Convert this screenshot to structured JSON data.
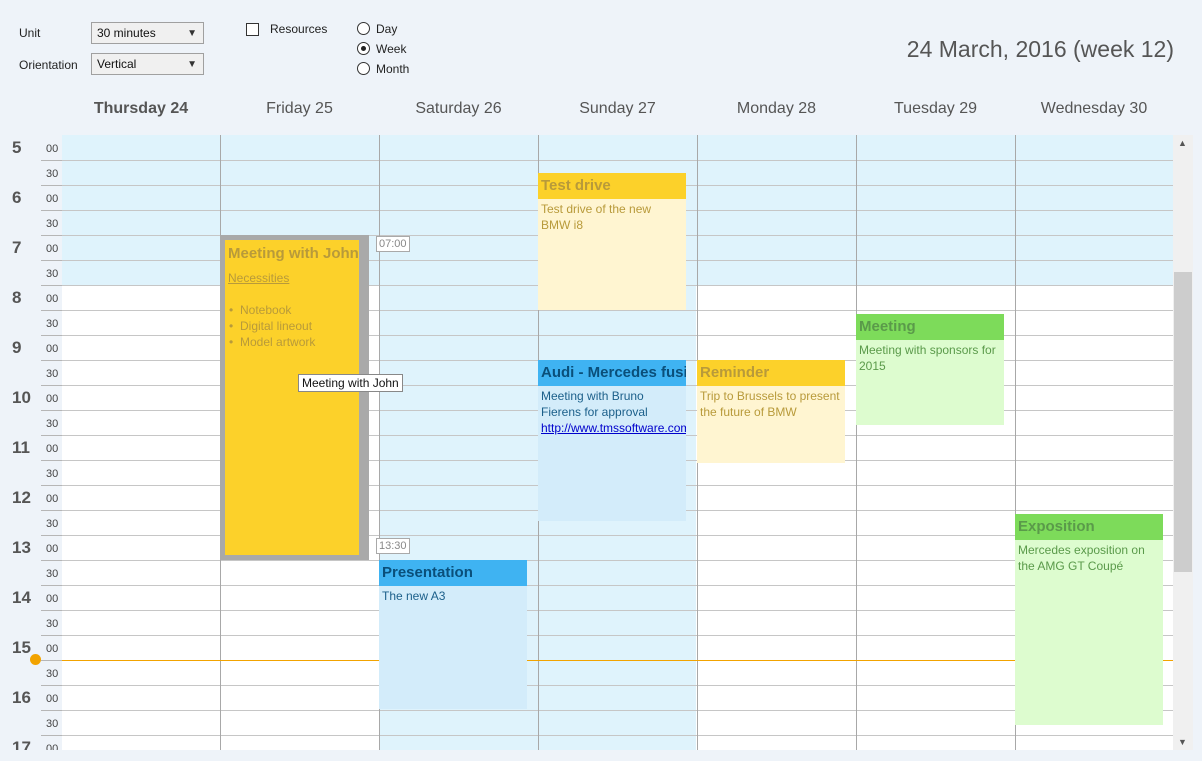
{
  "toolbar": {
    "unit_label": "Unit",
    "unit_value": "30 minutes",
    "orientation_label": "Orientation",
    "orientation_value": "Vertical",
    "resources_label": "Resources",
    "resources_checked": false,
    "view_options": [
      "Day",
      "Week",
      "Month"
    ],
    "view_selected": "Week"
  },
  "current_date": "24 March, 2016 (week 12)",
  "days": [
    "Thursday 24",
    "Friday 25",
    "Saturday 26",
    "Sunday 27",
    "Monday 28",
    "Tuesday 29",
    "Wednesday 30"
  ],
  "today_index": 0,
  "time_rows": {
    "hours": [
      "5",
      "6",
      "7",
      "8",
      "9",
      "10",
      "11",
      "12",
      "13",
      "14",
      "15",
      "16",
      "17"
    ],
    "minutes": [
      "00",
      "30"
    ]
  },
  "events": {
    "meeting_john": {
      "title": "Meeting with John",
      "link": "Necessities",
      "items": [
        "Notebook",
        "Digital lineout",
        "Model artwork"
      ],
      "start_tag": "07:00",
      "end_tag": "13:30",
      "tooltip": "Meeting with John"
    },
    "test_drive": {
      "title": "Test drive",
      "body": "Test drive of the new BMW i8"
    },
    "audi": {
      "title": "Audi - Mercedes fusion",
      "body": "Meeting with Bruno Fierens for approval",
      "url": "http://www.tmssoftware.com"
    },
    "presentation": {
      "title": "Presentation",
      "body": "The new A3"
    },
    "reminder": {
      "title": "Reminder",
      "body": "Trip to Brussels to present the future of BMW"
    },
    "meeting": {
      "title": "Meeting",
      "body": "Meeting with sponsors for 2015"
    },
    "exposition": {
      "title": "Exposition",
      "body": "Mercedes exposition on the AMG GT Coupé"
    }
  },
  "colors": {
    "work_hours_bg": "#dff3fc",
    "now_line": "#f2a300",
    "yellow_event": "#fcd12a",
    "blue_event": "#3fb3f2",
    "green_event": "#7ddb5a"
  }
}
